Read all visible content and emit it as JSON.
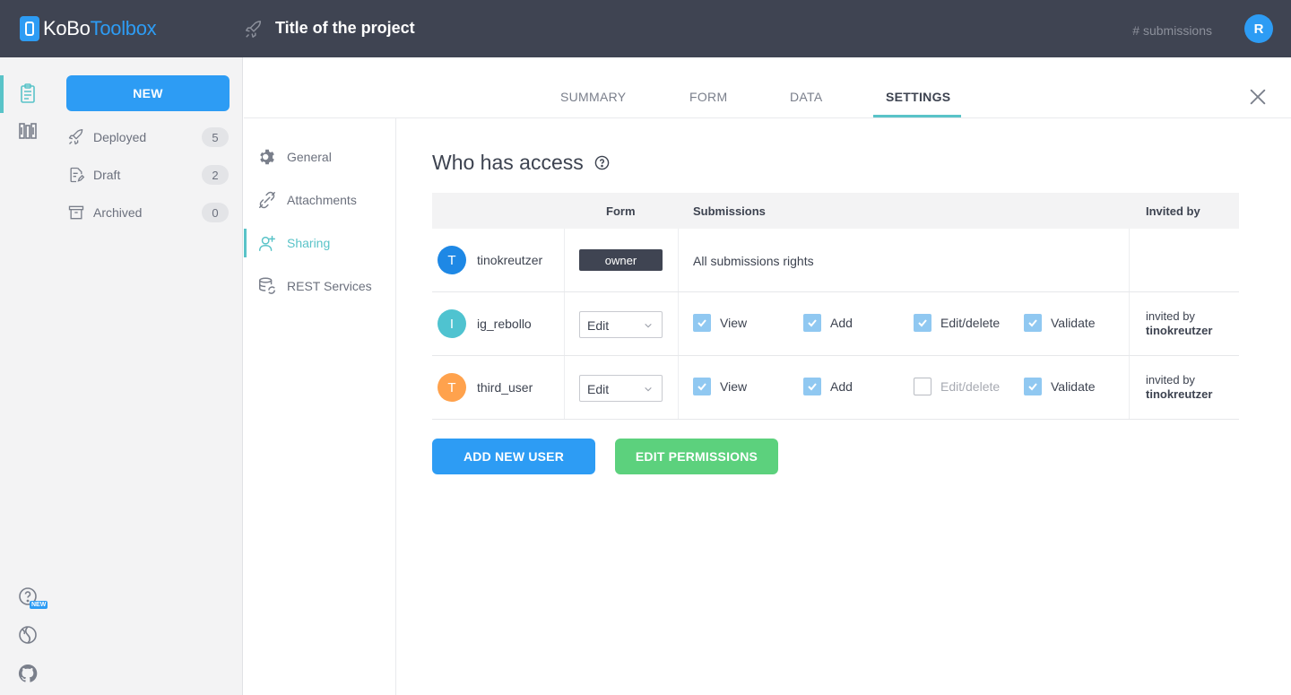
{
  "app": {
    "logo_ko": "KoBo",
    "logo_toolbox": "Toolbox",
    "project_title": "Title of the project",
    "submissions_label": "# submissions",
    "user_initial": "R"
  },
  "rail": {
    "new_badge": "NEW"
  },
  "sidebar": {
    "new_button": "NEW",
    "items": [
      {
        "label": "Deployed",
        "count": "5",
        "icon": "rocket-icon"
      },
      {
        "label": "Draft",
        "count": "2",
        "icon": "draft-icon"
      },
      {
        "label": "Archived",
        "count": "0",
        "icon": "archive-icon"
      }
    ]
  },
  "tabs": [
    {
      "label": "SUMMARY",
      "active": false
    },
    {
      "label": "FORM",
      "active": false
    },
    {
      "label": "DATA",
      "active": false
    },
    {
      "label": "SETTINGS",
      "active": true
    }
  ],
  "settings_nav": [
    {
      "label": "General",
      "icon": "gear-icon",
      "active": false
    },
    {
      "label": "Attachments",
      "icon": "attachment-icon",
      "active": false
    },
    {
      "label": "Sharing",
      "icon": "add-user-icon",
      "active": true
    },
    {
      "label": "REST Services",
      "icon": "database-sync-icon",
      "active": false
    }
  ],
  "sharing": {
    "heading": "Who has access",
    "columns": {
      "form": "Form",
      "submissions": "Submissions",
      "invited_by": "Invited by"
    },
    "users": [
      {
        "initial": "T",
        "username": "tinokreutzer",
        "color": "#1e88e5",
        "role": "owner",
        "submissions_text": "All submissions rights"
      },
      {
        "initial": "I",
        "username": "ig_rebollo",
        "color": "#4fc3d0",
        "form_permission": "Edit",
        "perms": [
          {
            "label": "View",
            "checked": true
          },
          {
            "label": "Add",
            "checked": true
          },
          {
            "label": "Edit/delete",
            "checked": true
          },
          {
            "label": "Validate",
            "checked": true
          }
        ],
        "invited_prefix": "invited by",
        "invited_by": "tinokreutzer"
      },
      {
        "initial": "T",
        "username": "third_user",
        "color": "#ffa24d",
        "form_permission": "Edit",
        "perms": [
          {
            "label": "View",
            "checked": true
          },
          {
            "label": "Add",
            "checked": true
          },
          {
            "label": "Edit/delete",
            "checked": false
          },
          {
            "label": "Validate",
            "checked": true
          }
        ],
        "invited_prefix": "invited by",
        "invited_by": "tinokreutzer"
      }
    ],
    "add_user_button": "ADD NEW USER",
    "edit_permissions_button": "EDIT PERMISSIONS"
  },
  "colors": {
    "topbar": "#3f4452",
    "primary": "#2d9cf4",
    "accent_teal": "#59c3c8",
    "success": "#5cd17d",
    "checkbox_on": "#90c8f1"
  }
}
